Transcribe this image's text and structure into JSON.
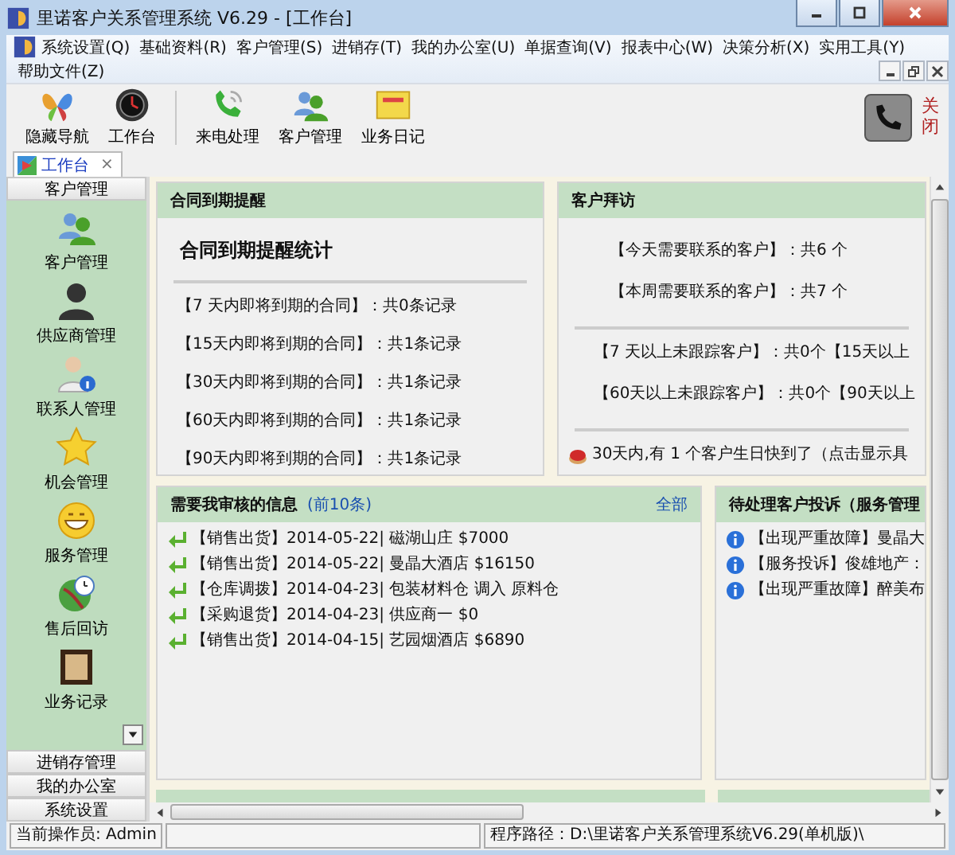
{
  "window": {
    "title": "里诺客户关系管理系统 V6.29 - [工作台]"
  },
  "menu_rows": [
    [
      "系统设置(Q)",
      "基础资料(R)",
      "客户管理(S)",
      "进销存(T)",
      "我的办公室(U)",
      "单据查询(V)",
      "报表中心(W)",
      "决策分析(X)",
      "实用工具(Y)"
    ],
    [
      "帮助文件(Z)"
    ]
  ],
  "toolbar_groups": [
    [
      "隐藏导航",
      "工作台"
    ],
    [
      "来电处理",
      "客户管理",
      "业务日记"
    ]
  ],
  "close_button": {
    "label": "关闭"
  },
  "tabs": [
    {
      "label": "工作台",
      "selected": true,
      "close": "×"
    }
  ],
  "sidebar": {
    "header": "客户管理",
    "items": [
      "客户管理",
      "供应商管理",
      "联系人管理",
      "机会管理",
      "服务管理",
      "售后回访",
      "业务记录"
    ],
    "sections": [
      "进销存管理",
      "我的办公室",
      "系统设置"
    ]
  },
  "contract_panel": {
    "title": "合同到期提醒",
    "subtitle": "合同到期提醒统计",
    "lines": [
      "【7 天内即将到期的合同】：共0条记录",
      "【15天内即将到期的合同】：共1条记录",
      "【30天内即将到期的合同】：共1条记录",
      "【60天内即将到期的合同】：共1条记录",
      "【90天内即将到期的合同】：共1条记录"
    ]
  },
  "visit_panel": {
    "title": "客户拜访",
    "contact_lines": [
      "【今天需要联系的客户】：共6 个",
      "【本周需要联系的客户】：共7 个"
    ],
    "untracked_rows": [
      [
        "【7 天以上未跟踪客户】：共0个",
        "【15天以上"
      ],
      [
        "【60天以上未跟踪客户】：共0个",
        "【90天以上"
      ]
    ],
    "birthday": "30天内,有 1 个客户生日快到了（点击显示具"
  },
  "review_panel": {
    "title": "需要我审核的信息",
    "count": "(前10条)",
    "all_link": "全部",
    "items": [
      "【销售出货】2014-05-22| 磁湖山庄 $7000",
      "【销售出货】2014-05-22| 曼晶大酒店 $16150",
      "【仓库调拨】2014-04-23| 包装材料仓 调入 原料仓",
      "【采购退货】2014-04-23| 供应商一 $0",
      "【销售出货】2014-04-15| 艺园烟酒店 $6890"
    ]
  },
  "complaint_panel": {
    "title": "待处理客户投诉（服务管理",
    "items": [
      "【出现严重故障】曼晶大",
      "【服务投诉】俊雄地产：",
      "【出现严重故障】醉美布"
    ]
  },
  "status_bar": {
    "operator": "当前操作员: Admin",
    "path": "程序路径：D:\\里诺客户关系管理系统V6.29(单机版)\\"
  }
}
